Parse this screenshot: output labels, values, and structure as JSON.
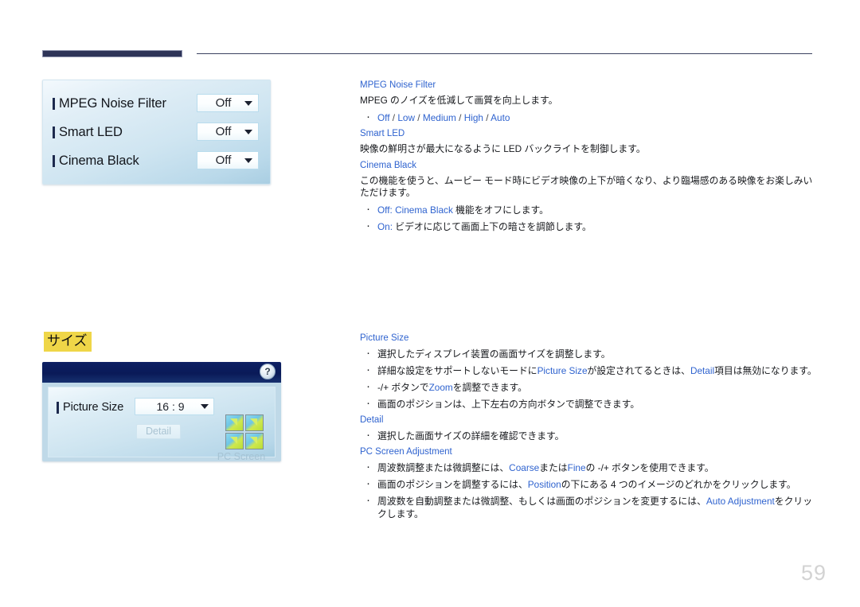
{
  "page": {
    "number": "59",
    "highlight_heading": "サイズ"
  },
  "osd_panel_picture": {
    "name": "picture-options-osd",
    "rows": [
      {
        "label": "MPEG Noise Filter",
        "value": "Off"
      },
      {
        "label": "Smart LED",
        "value": "Off"
      },
      {
        "label": "Cinema Black",
        "value": "Off"
      }
    ]
  },
  "osd_panel_size": {
    "name": "picture-size-osd",
    "help_glyph": "?",
    "picture_size_label": "Picture Size",
    "picture_size_value": "16 : 9",
    "detail_button": "Detail",
    "pc_screen_adjustment_label": "PC Screen Adjustment"
  },
  "doc_top": {
    "sections": [
      {
        "heading": "MPEG Noise Filter",
        "paragraph": "MPEG のノイズを低減して画質を向上します。",
        "bullets": [
          {
            "parts": [
              {
                "t": "Off",
                "c": "blue"
              },
              {
                "t": " / ",
                "c": "sep"
              },
              {
                "t": "Low",
                "c": "blue"
              },
              {
                "t": " / ",
                "c": "sep"
              },
              {
                "t": "Medium",
                "c": "blue"
              },
              {
                "t": " / ",
                "c": "sep"
              },
              {
                "t": "High",
                "c": "blue"
              },
              {
                "t": " / ",
                "c": "sep"
              },
              {
                "t": "Auto",
                "c": "blue"
              }
            ]
          }
        ]
      },
      {
        "heading": "Smart LED",
        "paragraph": "映像の鮮明さが最大になるように LED バックライトを制御します。",
        "bullets": []
      },
      {
        "heading": "Cinema Black",
        "paragraph": "この機能を使うと、ムービー モード時にビデオ映像の上下が暗くなり、より臨場感のある映像をお楽しみいただけます。",
        "bullets": [
          {
            "parts": [
              {
                "t": "Off: Cinema Black",
                "c": "blue"
              },
              {
                "t": " 機能をオフにします。",
                "c": "plain"
              }
            ]
          },
          {
            "parts": [
              {
                "t": "On:",
                "c": "blue"
              },
              {
                "t": " ビデオに応じて画面上下の暗さを調節します。",
                "c": "plain"
              }
            ]
          }
        ]
      }
    ]
  },
  "doc_bottom": {
    "sections": [
      {
        "heading": "Picture Size",
        "paragraph": "",
        "bullets": [
          {
            "parts": [
              {
                "t": "選択したディスプレイ装置の画面サイズを調整します。",
                "c": "plain"
              }
            ]
          },
          {
            "parts": [
              {
                "t": "詳細な設定をサポートしないモードに",
                "c": "plain"
              },
              {
                "t": "Picture Size",
                "c": "blue"
              },
              {
                "t": "が設定されてるときは、",
                "c": "plain"
              },
              {
                "t": "Detail",
                "c": "blue"
              },
              {
                "t": "項目は無効になります。",
                "c": "plain"
              }
            ]
          },
          {
            "parts": [
              {
                "t": "-/+ ボタンで",
                "c": "plain"
              },
              {
                "t": "Zoom",
                "c": "blue"
              },
              {
                "t": "を調整できます。",
                "c": "plain"
              }
            ]
          },
          {
            "parts": [
              {
                "t": "画面のポジションは、上下左右の方向ボタンで調整できます。",
                "c": "plain"
              }
            ]
          }
        ]
      },
      {
        "heading": "Detail",
        "paragraph": "",
        "bullets": [
          {
            "parts": [
              {
                "t": "選択した画面サイズの詳細を確認できます。",
                "c": "plain"
              }
            ]
          }
        ]
      },
      {
        "heading": "PC Screen Adjustment",
        "paragraph": "",
        "bullets": [
          {
            "parts": [
              {
                "t": "周波数調整または微調整には、",
                "c": "plain"
              },
              {
                "t": "Coarse",
                "c": "blue"
              },
              {
                "t": "または",
                "c": "plain"
              },
              {
                "t": "Fine",
                "c": "blue"
              },
              {
                "t": "の -/+ ボタンを使用できます。",
                "c": "plain"
              }
            ]
          },
          {
            "parts": [
              {
                "t": "画面のポジションを調整するには、",
                "c": "plain"
              },
              {
                "t": "Position",
                "c": "blue"
              },
              {
                "t": "の下にある 4 つのイメージのどれかをクリックします。",
                "c": "plain"
              }
            ]
          },
          {
            "parts": [
              {
                "t": "周波数を自動調整または微調整、もしくは画面のポジションを変更するには、",
                "c": "plain"
              },
              {
                "t": "Auto Adjustment",
                "c": "blue"
              },
              {
                "t": "をクリックします。",
                "c": "plain"
              }
            ]
          }
        ]
      }
    ]
  },
  "colors": {
    "accent_blue": "#2f63cf",
    "header_navy": "#2e3458",
    "highlight_yellow": "#efd648",
    "page_number_gray": "#d3d3d3"
  }
}
